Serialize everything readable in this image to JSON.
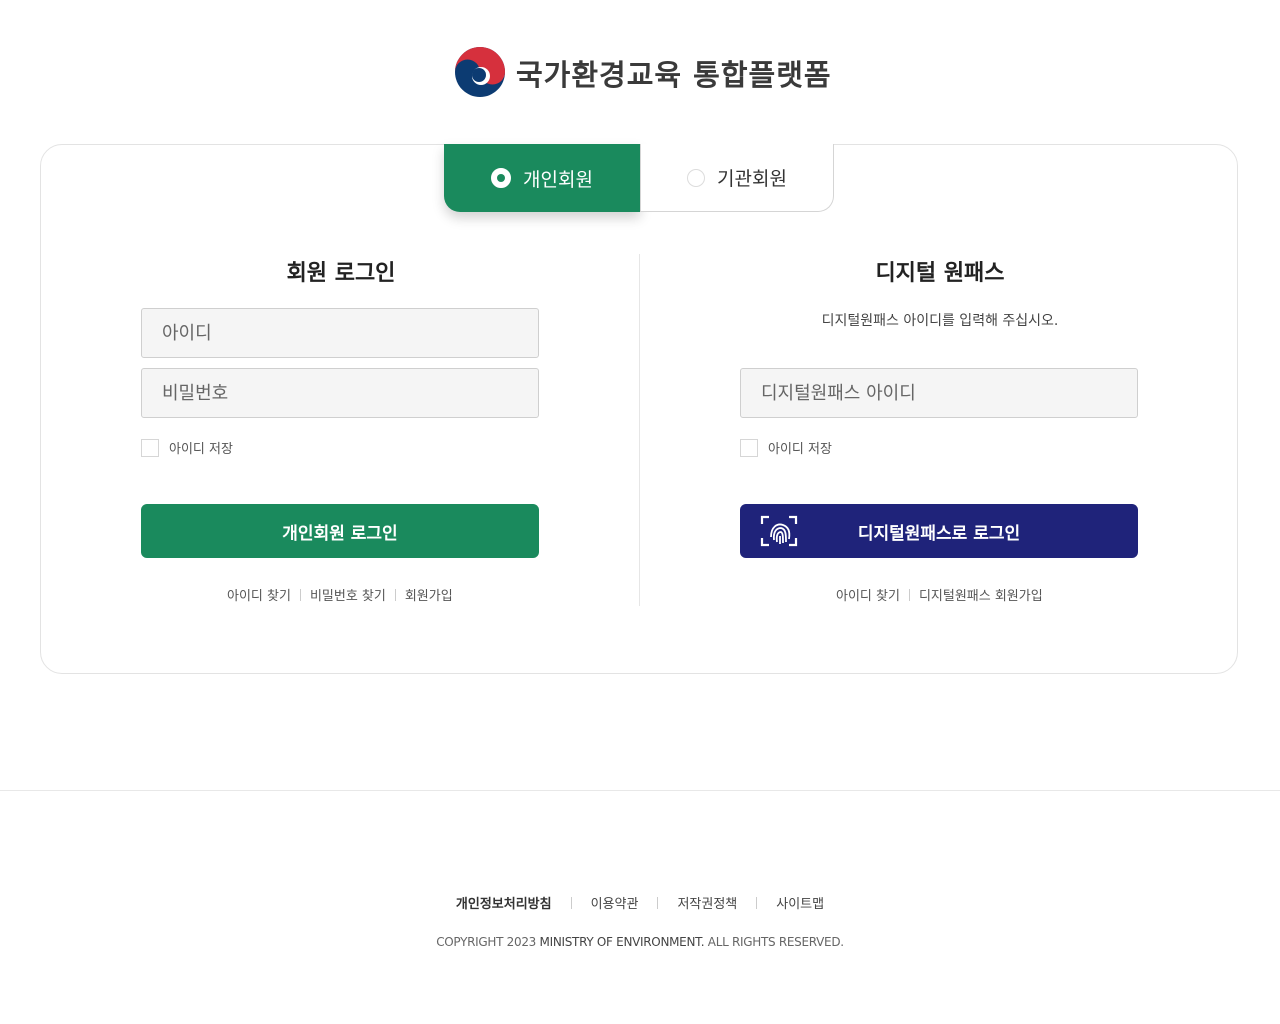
{
  "header": {
    "brand": "국가환경교육 통합플랫폼"
  },
  "tabs": {
    "personal": "개인회원",
    "organization": "기관회원"
  },
  "member_login": {
    "title": "회원 로그인",
    "id_placeholder": "아이디",
    "password_placeholder": "비밀번호",
    "remember_label": "아이디 저장",
    "login_button": "개인회원 로그인",
    "links": {
      "find_id": "아이디 찾기",
      "find_password": "비밀번호 찾기",
      "signup": "회원가입"
    }
  },
  "digital_onepass": {
    "title": "디지털 원패스",
    "description": "디지털원패스 아이디를 입력해 주십시오.",
    "id_placeholder": "디지털원패스 아이디",
    "remember_label": "아이디 저장",
    "login_button": "디지털원패스로 로그인",
    "links": {
      "find_id": "아이디 찾기",
      "signup": "디지털원패스 회원가입"
    }
  },
  "footer": {
    "links": {
      "privacy": "개인정보처리방침",
      "terms": "이용약관",
      "copyright_policy": "저작권정책",
      "sitemap": "사이트맵"
    },
    "copyright_prefix": "COPYRIGHT 2023",
    "copyright_org": "MINISTRY OF ENVIRONMENT.",
    "copyright_suffix": "ALL RIGHTS RESERVED."
  },
  "colors": {
    "primary_green": "#1a8a5d",
    "onepass_navy": "#1f237a"
  },
  "icons": {
    "logo": "taegeuk-logo-icon",
    "onepass": "fingerprint-icon"
  }
}
